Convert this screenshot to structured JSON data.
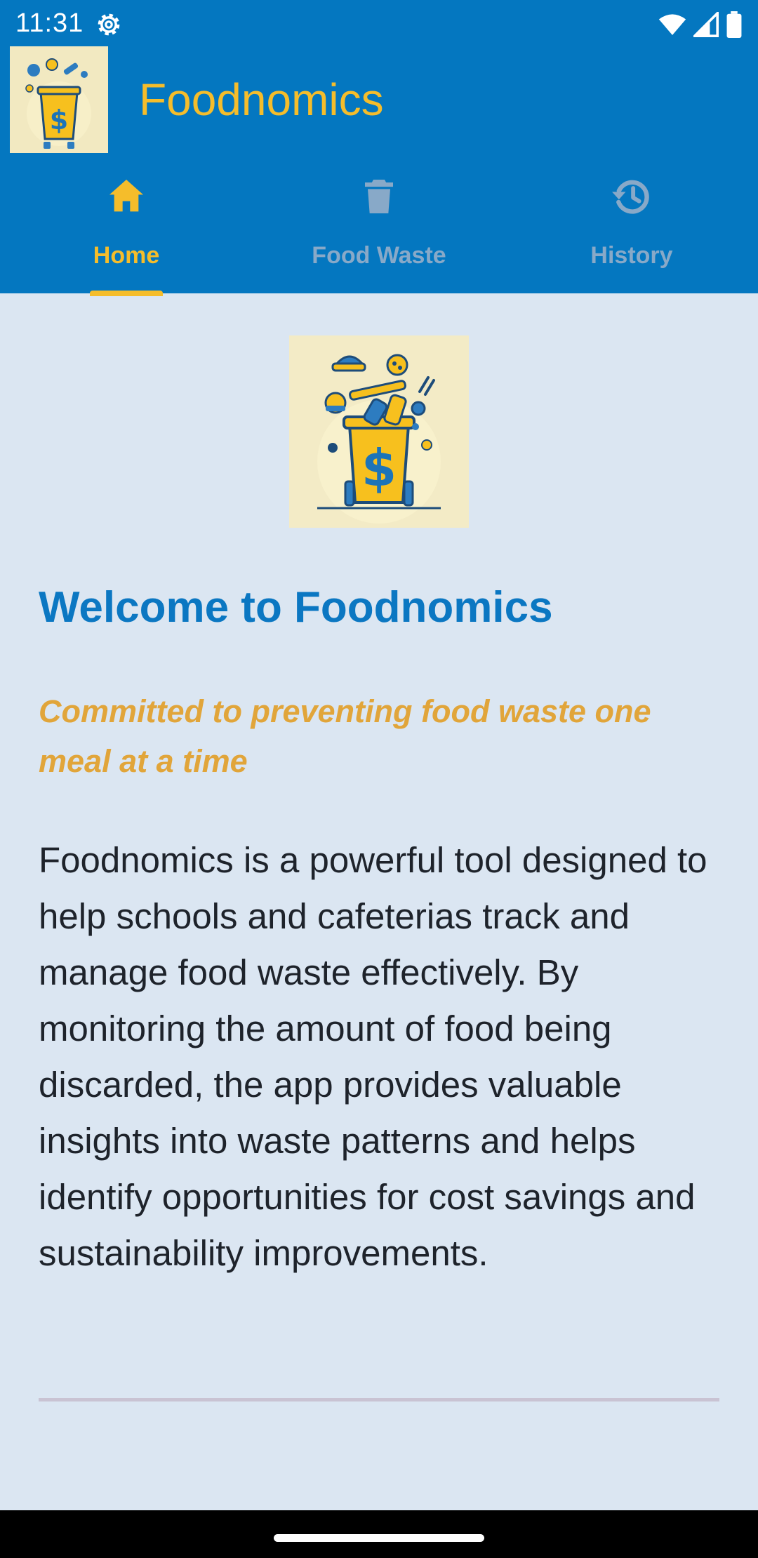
{
  "status_bar": {
    "time": "11:31",
    "icons": [
      "settings-gear-icon",
      "wifi-icon",
      "cellular-signal-icon",
      "battery-icon"
    ]
  },
  "app": {
    "title": "Foodnomics",
    "logo": "foodnomics-logo",
    "colors": {
      "primary": "#0477c0",
      "accent": "#f5bd2b",
      "background": "#dbe6f2",
      "heading": "#0b77c2",
      "tagline": "#e1a53a"
    }
  },
  "tabs": [
    {
      "label": "Home",
      "icon": "home-icon",
      "active": true
    },
    {
      "label": "Food Waste",
      "icon": "trash-icon",
      "active": false
    },
    {
      "label": "History",
      "icon": "history-icon",
      "active": false
    }
  ],
  "home": {
    "hero_image": "foodnomics-trash-can-illustration",
    "title": "Welcome to Foodnomics",
    "tagline": "Committed to preventing food waste one meal at a time",
    "description": "Foodnomics is a powerful tool designed to help schools and cafeterias track and manage food waste effectively. By monitoring the amount of food being discarded, the app provides valuable insights into waste patterns and helps identify opportunities for cost savings and sustainability improvements."
  }
}
